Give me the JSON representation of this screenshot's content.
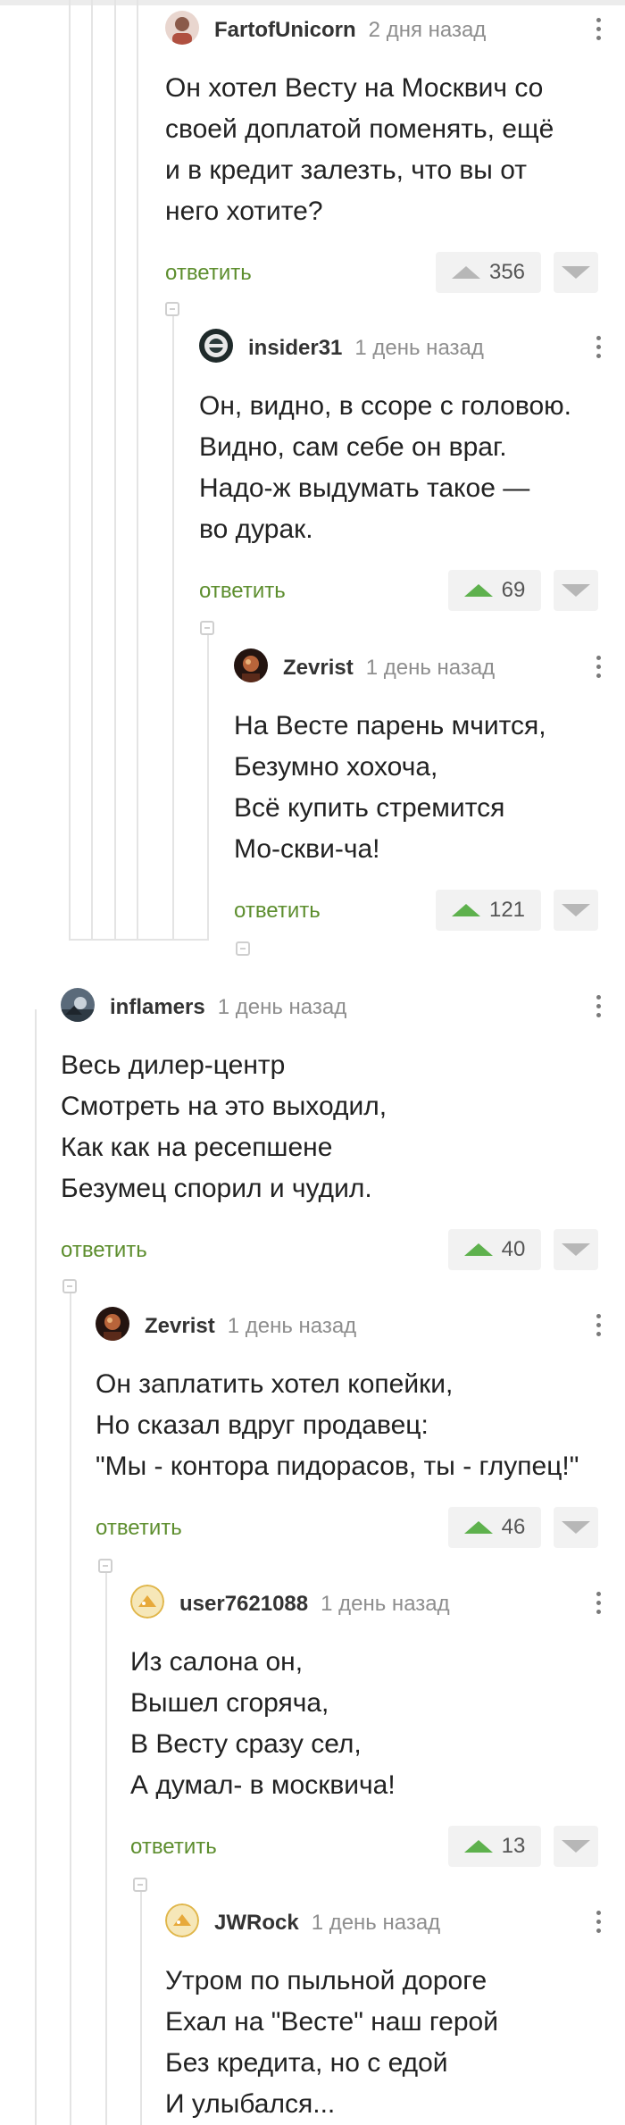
{
  "comments": [
    {
      "username": "FartofUnicorn",
      "time": "2 дня назад",
      "lines": [
        "Он хотел Весту на Москвич со",
        "своей доплатой поменять, ещё",
        "и в кредит залезть, что вы от",
        "него хотите?"
      ],
      "reply_label": "ответить",
      "rating": "356"
    },
    {
      "username": "insider31",
      "time": "1 день назад",
      "lines": [
        "Он, видно, в ссоре с головою.",
        "Видно, сам себе он враг.",
        "Надо-ж выдумать такое —",
        "во дурак."
      ],
      "reply_label": "ответить",
      "rating": "69"
    },
    {
      "username": "Zevrist",
      "time": "1 день назад",
      "lines": [
        "На Весте парень мчится,",
        "Безумно хохоча,",
        "Всё купить стремится",
        "Мо-скви-ча!"
      ],
      "reply_label": "ответить",
      "rating": "121"
    },
    {
      "username": "inflamers",
      "time": "1 день назад",
      "lines": [
        "Весь дилер-центр",
        "Смотреть на это выходил,",
        "Как как на ресепшене",
        "Безумец спорил и чудил."
      ],
      "reply_label": "ответить",
      "rating": "40"
    },
    {
      "username": "Zevrist",
      "time": "1 день назад",
      "lines": [
        "Он заплатить хотел копейки,",
        "Но сказал вдруг продавец:",
        "\"Мы - контора пидорасов, ты - глупец!\""
      ],
      "reply_label": "ответить",
      "rating": "46"
    },
    {
      "username": "user7621088",
      "time": "1 день назад",
      "lines": [
        "Из салона он,",
        "Вышел сгоряча,",
        "В Весту сразу сел,",
        "А думал- в москвича!"
      ],
      "reply_label": "ответить",
      "rating": "13"
    },
    {
      "username": "JWRock",
      "time": "1 день назад",
      "lines": [
        "Утром по пыльной дороге",
        "Ехал на \"Весте\" наш герой",
        "Без кредита, но с едой",
        "И улыбался..."
      ]
    }
  ],
  "colors": {
    "reply": "#5d8e2e",
    "upvote_active": "#5eb14d",
    "upvote_inactive": "#b7b7b7"
  },
  "icons": [
    "collapse-icon",
    "more-icon",
    "upvote-icon",
    "downvote-icon"
  ]
}
